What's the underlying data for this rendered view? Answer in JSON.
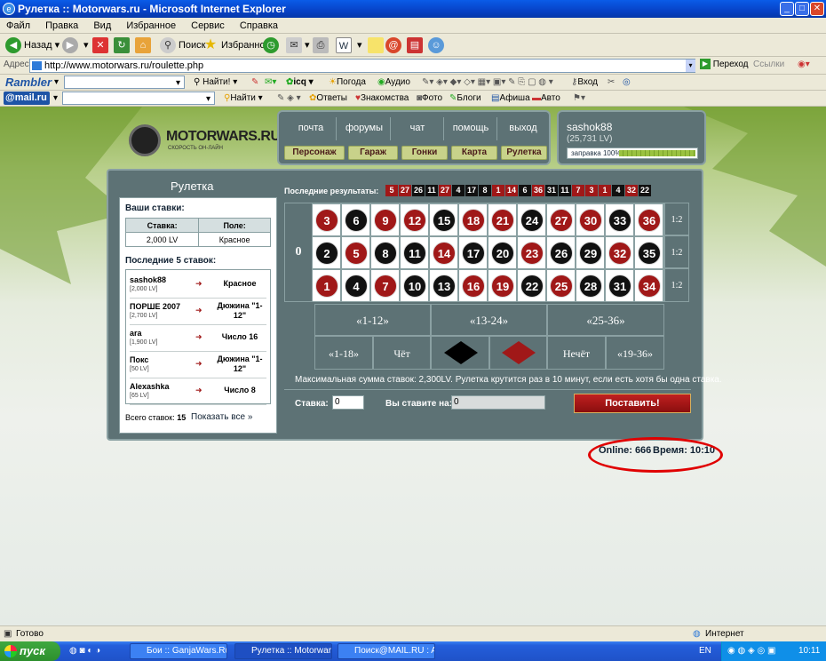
{
  "window": {
    "title": "Рулетка :: Motorwars.ru - Microsoft Internet Explorer"
  },
  "menu": [
    "Файл",
    "Правка",
    "Вид",
    "Избранное",
    "Сервис",
    "Справка"
  ],
  "toolbar": {
    "back": "Назад",
    "search": "Поиск",
    "favorites": "Избранное"
  },
  "address": {
    "label": "Адрес:",
    "url": "http://www.motorwars.ru/roulette.php",
    "go": "Переход",
    "links": "Ссылки"
  },
  "rambler": {
    "logo": "Rambler",
    "find": "Найти!",
    "icq": "icq",
    "weather": "Погода",
    "audio": "Аудио",
    "login": "Вход"
  },
  "mailru": {
    "logo": "@mail.ru",
    "find": "Найти",
    "answers": "Ответы",
    "dating": "Знакомства",
    "photo": "Фото",
    "blogs": "Блоги",
    "poster": "Афиша",
    "auto": "Авто"
  },
  "site": {
    "logo_name": "MOTORWARS.RU",
    "logo_slogan": "СКОРОСТЬ ОН-ЛАЙН",
    "nav_top": [
      "почта",
      "форумы",
      "чат",
      "помощь",
      "выход"
    ],
    "nav_buttons": [
      "Персонаж",
      "Гараж",
      "Гонки",
      "Карта",
      "Рулетка"
    ],
    "user": {
      "name": "sashok88",
      "balance": "(25,731 LV)",
      "fuel": "заправка 100%",
      "fuel_level": 100
    }
  },
  "roulette": {
    "title": "Рулетка",
    "your_bets_label": "Ваши ставки:",
    "bet_headers": [
      "Ставка:",
      "Поле:"
    ],
    "bet_row": [
      "2,000 LV",
      "Красное"
    ],
    "last5_label": "Последние 5 ставок:",
    "history": [
      {
        "name": "sashok88",
        "amount": "[2,000 LV]",
        "field": "Красное"
      },
      {
        "name": "ПОРШЕ 2007",
        "amount": "[2,700 LV]",
        "field": "Дюжина \"1-12\""
      },
      {
        "name": "ara",
        "amount": "[1,900 LV]",
        "field": "Число 16"
      },
      {
        "name": "Покс",
        "amount": "[50 LV]",
        "field": "Дюжина \"1-12\""
      },
      {
        "name": "Alexashka",
        "amount": "[65 LV]",
        "field": "Число 8"
      }
    ],
    "total_label": "Всего ставок:",
    "total_count": "15",
    "show_all": "Показать все »",
    "last_results_label": "Последние результаты:",
    "last_results": [
      {
        "n": "5",
        "c": "red"
      },
      {
        "n": "27",
        "c": "red"
      },
      {
        "n": "26",
        "c": "blk"
      },
      {
        "n": "11",
        "c": "blk"
      },
      {
        "n": "27",
        "c": "red"
      },
      {
        "n": "4",
        "c": "blk"
      },
      {
        "n": "17",
        "c": "blk"
      },
      {
        "n": "8",
        "c": "blk"
      },
      {
        "n": "1",
        "c": "red"
      },
      {
        "n": "14",
        "c": "red"
      },
      {
        "n": "6",
        "c": "blk"
      },
      {
        "n": "36",
        "c": "red"
      },
      {
        "n": "31",
        "c": "blk"
      },
      {
        "n": "11",
        "c": "blk"
      },
      {
        "n": "7",
        "c": "red"
      },
      {
        "n": "3",
        "c": "red"
      },
      {
        "n": "1",
        "c": "red"
      },
      {
        "n": "4",
        "c": "blk"
      },
      {
        "n": "32",
        "c": "red"
      },
      {
        "n": "22",
        "c": "blk"
      }
    ],
    "zero": "0",
    "rows": [
      [
        {
          "n": "3",
          "c": "red"
        },
        {
          "n": "6",
          "c": "blk"
        },
        {
          "n": "9",
          "c": "red"
        },
        {
          "n": "12",
          "c": "red"
        },
        {
          "n": "15",
          "c": "blk"
        },
        {
          "n": "18",
          "c": "red"
        },
        {
          "n": "21",
          "c": "red"
        },
        {
          "n": "24",
          "c": "blk"
        },
        {
          "n": "27",
          "c": "red"
        },
        {
          "n": "30",
          "c": "red"
        },
        {
          "n": "33",
          "c": "blk"
        },
        {
          "n": "36",
          "c": "red"
        }
      ],
      [
        {
          "n": "2",
          "c": "blk"
        },
        {
          "n": "5",
          "c": "red"
        },
        {
          "n": "8",
          "c": "blk"
        },
        {
          "n": "11",
          "c": "blk"
        },
        {
          "n": "14",
          "c": "red"
        },
        {
          "n": "17",
          "c": "blk"
        },
        {
          "n": "20",
          "c": "blk"
        },
        {
          "n": "23",
          "c": "red"
        },
        {
          "n": "26",
          "c": "blk"
        },
        {
          "n": "29",
          "c": "blk"
        },
        {
          "n": "32",
          "c": "red"
        },
        {
          "n": "35",
          "c": "blk"
        }
      ],
      [
        {
          "n": "1",
          "c": "red"
        },
        {
          "n": "4",
          "c": "blk"
        },
        {
          "n": "7",
          "c": "red"
        },
        {
          "n": "10",
          "c": "blk"
        },
        {
          "n": "13",
          "c": "blk"
        },
        {
          "n": "16",
          "c": "red"
        },
        {
          "n": "19",
          "c": "red"
        },
        {
          "n": "22",
          "c": "blk"
        },
        {
          "n": "25",
          "c": "red"
        },
        {
          "n": "28",
          "c": "blk"
        },
        {
          "n": "31",
          "c": "blk"
        },
        {
          "n": "34",
          "c": "red"
        }
      ]
    ],
    "column_bets": [
      "1:2",
      "1:2",
      "1:2"
    ],
    "dozens": [
      "«1-12»",
      "«13-24»",
      "«25-36»"
    ],
    "outside": [
      "«1-18»",
      "Чёт",
      "",
      "",
      "Нечёт",
      "«19-36»"
    ],
    "max_note": "Максимальная сумма ставок: 2,300LV. Рулетка крутится раз в 10 минут, если есть хотя бы одна ставка.",
    "stake_label": "Ставка:",
    "stake_value": "0",
    "target_label": "Вы ставите на:",
    "target_value": "0",
    "submit": "Поставить!",
    "online": "Online: 666",
    "time": "Время: 10:10"
  },
  "statusbar": {
    "done": "Готово",
    "zone": "Интернет"
  },
  "taskbar": {
    "start": "пуск",
    "tasks": [
      "Бои :: GanjaWars.Ru...",
      "Рулетка :: Motorwar...",
      "Поиск@MAIL.RU : A..."
    ],
    "lang": "EN",
    "clock": "10:11"
  },
  "colors": {
    "red": "#a01818",
    "black": "#111111",
    "panel": "#5d7275",
    "xp_blue": "#0a5ce8"
  }
}
